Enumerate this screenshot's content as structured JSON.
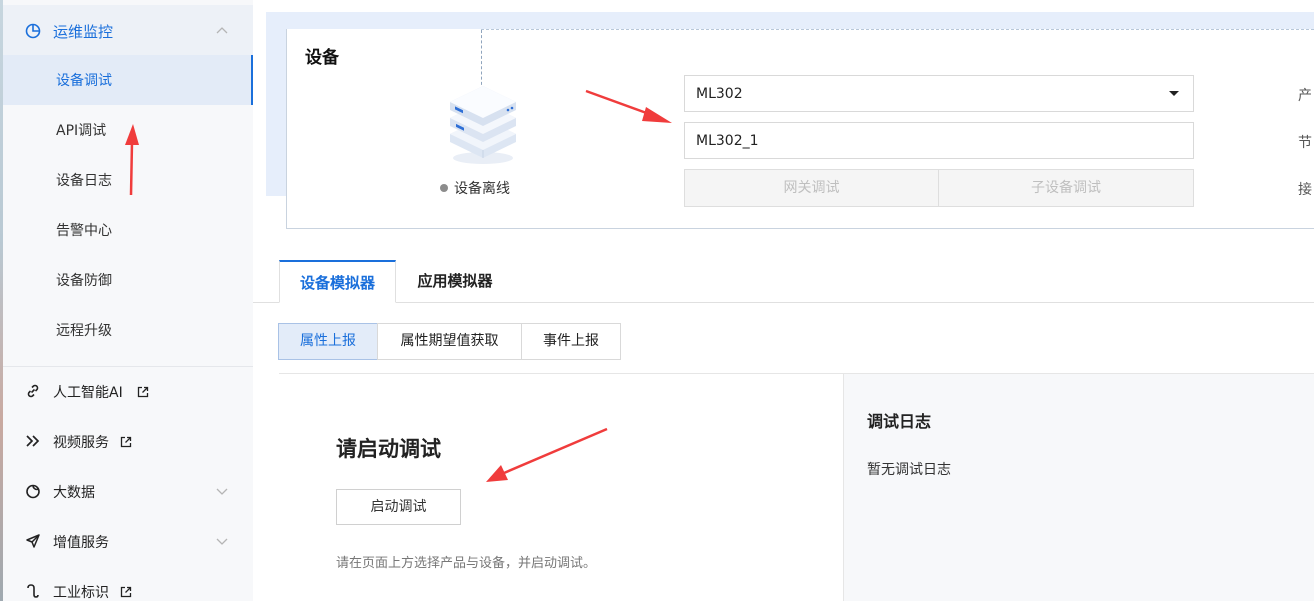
{
  "sidebar": {
    "section": {
      "label": "运维监控",
      "icon": "pie-chart-icon",
      "expanded": true
    },
    "sub_items": [
      {
        "label": "设备调试",
        "active": true
      },
      {
        "label": "API调试"
      },
      {
        "label": "设备日志"
      },
      {
        "label": "告警中心"
      },
      {
        "label": "设备防御"
      },
      {
        "label": "远程升级"
      }
    ],
    "groups": [
      {
        "label": "人工智能AI",
        "icon": "link-icon",
        "external": true
      },
      {
        "label": "视频服务",
        "icon": "play-forward-icon",
        "external": true
      },
      {
        "label": "大数据",
        "icon": "moon-icon",
        "expandable": true
      },
      {
        "label": "增值服务",
        "icon": "send-icon",
        "expandable": true
      },
      {
        "label": "工业标识",
        "icon": "hook-icon",
        "external": true
      }
    ]
  },
  "device_card": {
    "title": "设备",
    "status": "设备离线",
    "product_select": "ML302",
    "device_input": "ML302_1",
    "gateway_button": "网关调试",
    "subdevice_button": "子设备调试",
    "side_labels": [
      "产",
      "节",
      "接"
    ]
  },
  "tabs": [
    "设备模拟器",
    "应用模拟器"
  ],
  "sub_tabs": [
    "属性上报",
    "属性期望值获取",
    "事件上报"
  ],
  "main": {
    "start_title": "请启动调试",
    "start_button": "启动调试",
    "hint": "请在页面上方选择产品与设备，并启动调试。",
    "log_title": "调试日志",
    "log_empty": "暂无调试日志"
  },
  "colors": {
    "accent": "#1a6fdb",
    "annotation_arrow": "#f03c3c"
  }
}
